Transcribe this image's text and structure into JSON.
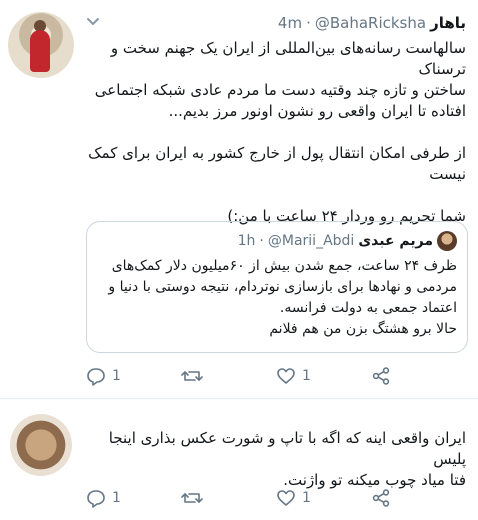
{
  "tweet1": {
    "display_name": "باهار",
    "handle": "@BahaRicksha",
    "separator": "·",
    "time": "4m",
    "lines": [
      "سالهاست رسانه‌های بین‌المللی از ایران یک جهنم سخت و ترسناک",
      "ساختن و تازه چند وقتیه دست ما مردم عادی شبکه اجتماعی",
      "افتاده تا ایران واقعی رو نشون اونور مرز بدیم...",
      "",
      "از طرفی امکان انتقال پول از خارج کشور به ایران برای کمک",
      "نیست",
      "",
      "شما تحریم رو وردار ۲۴ ساعت با من:)"
    ],
    "reply_count": "1",
    "retweet_count": "",
    "like_count": "1"
  },
  "quoted": {
    "display_name": "مریم عبدی",
    "handle": "@Marii_Abdi",
    "separator": "·",
    "time": "1h",
    "lines": [
      "ظرف ۲۴ ساعت، جمع شدن بیش از ۶۰میلیون دلار کمک‌های",
      "مردمی و نهادها برای بازسازی نوتردام، نتیجه دوستی با دنیا و",
      "اعتماد جمعی به دولت فرانسه.",
      "حالا برو هشتگ بزن من هم فلانم"
    ]
  },
  "tweet2": {
    "lines": [
      "ایران واقعی اینه که اگه با تاپ و شورت عکس بذاری اینجا پلیس",
      "فتا میاد چوب میکنه تو واژنت."
    ],
    "reply_count": "1",
    "like_count": "1"
  },
  "colors": {
    "text": "#14171a",
    "muted": "#657786",
    "border": "#ccd6dd",
    "divider": "#e6ecf0"
  },
  "icons": {
    "reply": "reply-icon",
    "retweet": "retweet-icon",
    "like": "heart-icon",
    "share": "share-icon",
    "menu": "chevron-down-icon"
  }
}
